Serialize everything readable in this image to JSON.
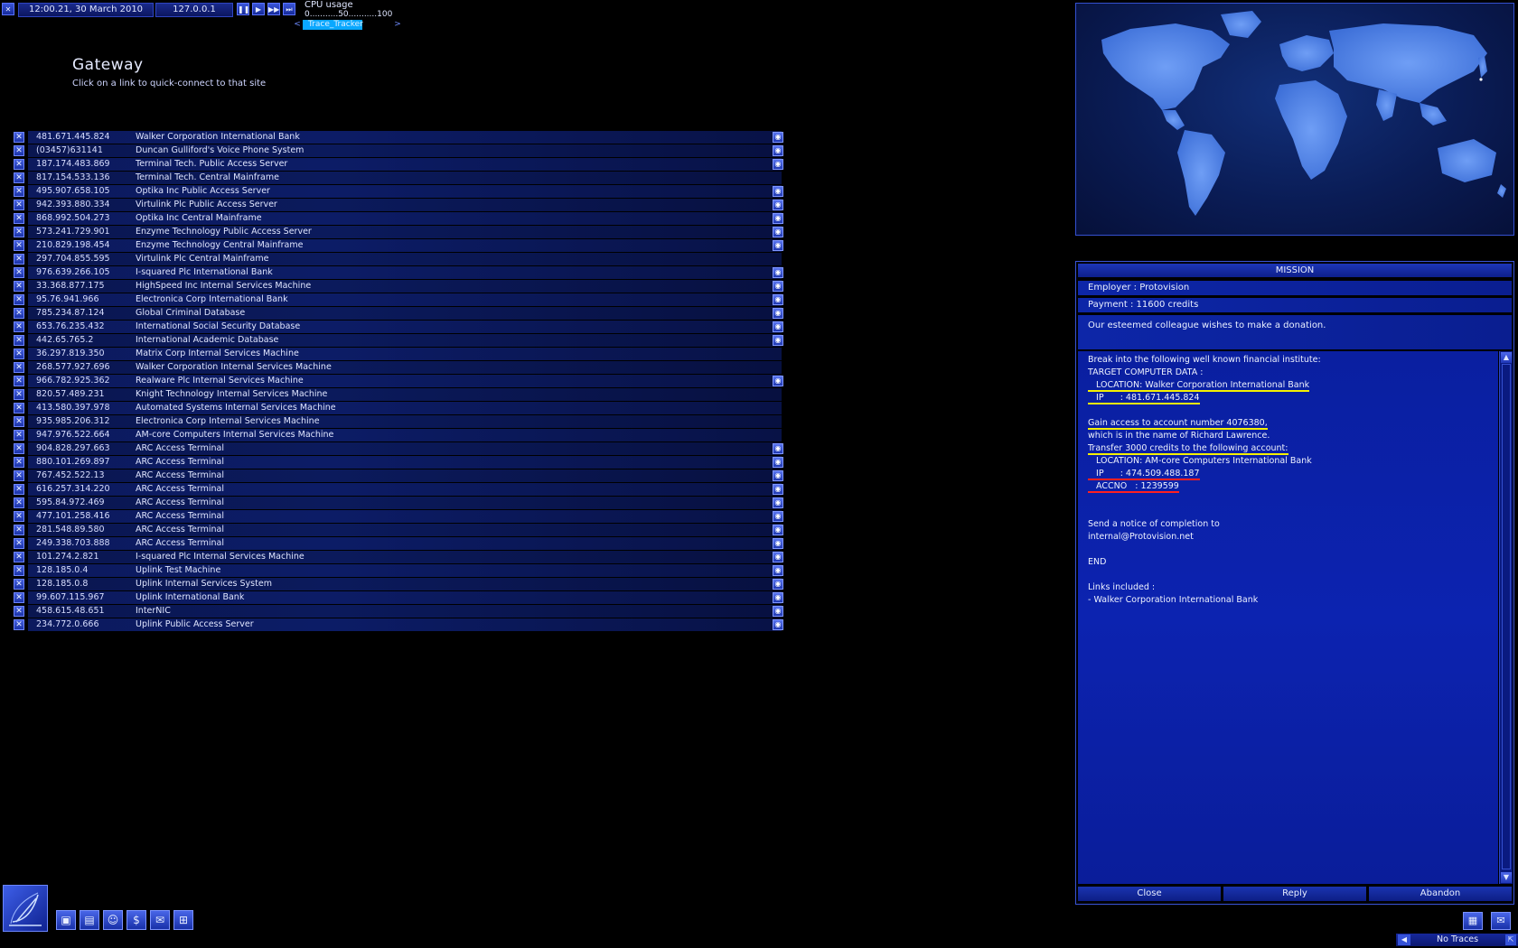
{
  "topbar": {
    "datetime": "12:00.21, 30 March 2010",
    "local_ip": "127.0.0.1",
    "cpu_label": "CPU usage",
    "cpu_scale": "0...........50...........100",
    "trace_program": "Trace_Tracker"
  },
  "gateway": {
    "title": "Gateway",
    "subtitle": "Click on a link to quick-connect to that site",
    "links": [
      {
        "ip": "481.671.445.824",
        "name": "Walker Corporation International Bank",
        "icon": true
      },
      {
        "ip": "(03457)631141",
        "name": "Duncan Gulliford's Voice Phone System",
        "icon": true
      },
      {
        "ip": "187.174.483.869",
        "name": "Terminal Tech. Public Access Server",
        "icon": true
      },
      {
        "ip": "817.154.533.136",
        "name": "Terminal Tech. Central Mainframe",
        "icon": false
      },
      {
        "ip": "495.907.658.105",
        "name": "Optika Inc Public Access Server",
        "icon": true
      },
      {
        "ip": "942.393.880.334",
        "name": "Virtulink Plc Public Access Server",
        "icon": true
      },
      {
        "ip": "868.992.504.273",
        "name": "Optika Inc Central Mainframe",
        "icon": true
      },
      {
        "ip": "573.241.729.901",
        "name": "Enzyme Technology Public Access Server",
        "icon": true
      },
      {
        "ip": "210.829.198.454",
        "name": "Enzyme Technology Central Mainframe",
        "icon": true
      },
      {
        "ip": "297.704.855.595",
        "name": "Virtulink Plc Central Mainframe",
        "icon": false
      },
      {
        "ip": "976.639.266.105",
        "name": "I-squared Plc International Bank",
        "icon": true
      },
      {
        "ip": "33.368.877.175",
        "name": "HighSpeed Inc Internal Services Machine",
        "icon": true
      },
      {
        "ip": "95.76.941.966",
        "name": "Electronica Corp International Bank",
        "icon": true
      },
      {
        "ip": "785.234.87.124",
        "name": "Global Criminal Database",
        "icon": true
      },
      {
        "ip": "653.76.235.432",
        "name": "International Social Security Database",
        "icon": true
      },
      {
        "ip": "442.65.765.2",
        "name": "International Academic Database",
        "icon": true
      },
      {
        "ip": "36.297.819.350",
        "name": "Matrix Corp Internal Services Machine",
        "icon": false
      },
      {
        "ip": "268.577.927.696",
        "name": "Walker Corporation Internal Services Machine",
        "icon": false
      },
      {
        "ip": "966.782.925.362",
        "name": "Realware Plc Internal Services Machine",
        "icon": true
      },
      {
        "ip": "820.57.489.231",
        "name": "Knight Technology Internal Services Machine",
        "icon": false
      },
      {
        "ip": "413.580.397.978",
        "name": "Automated Systems Internal Services Machine",
        "icon": false
      },
      {
        "ip": "935.985.206.312",
        "name": "Electronica Corp Internal Services Machine",
        "icon": false
      },
      {
        "ip": "947.976.522.664",
        "name": "AM-core Computers Internal Services Machine",
        "icon": false
      },
      {
        "ip": "904.828.297.663",
        "name": "ARC Access Terminal",
        "icon": true
      },
      {
        "ip": "880.101.269.897",
        "name": "ARC Access Terminal",
        "icon": true
      },
      {
        "ip": "767.452.522.13",
        "name": "ARC Access Terminal",
        "icon": true
      },
      {
        "ip": "616.257.314.220",
        "name": "ARC Access Terminal",
        "icon": true
      },
      {
        "ip": "595.84.972.469",
        "name": "ARC Access Terminal",
        "icon": true
      },
      {
        "ip": "477.101.258.416",
        "name": "ARC Access Terminal",
        "icon": true
      },
      {
        "ip": "281.548.89.580",
        "name": "ARC Access Terminal",
        "icon": true
      },
      {
        "ip": "249.338.703.888",
        "name": "ARC Access Terminal",
        "icon": true
      },
      {
        "ip": "101.274.2.821",
        "name": "I-squared Plc Internal Services Machine",
        "icon": true
      },
      {
        "ip": "128.185.0.4",
        "name": "Uplink Test Machine",
        "icon": true
      },
      {
        "ip": "128.185.0.8",
        "name": "Uplink Internal Services System",
        "icon": true
      },
      {
        "ip": "99.607.115.967",
        "name": "Uplink International Bank",
        "icon": true
      },
      {
        "ip": "458.615.48.651",
        "name": "InterNIC",
        "icon": true
      },
      {
        "ip": "234.772.0.666",
        "name": "Uplink Public Access Server",
        "icon": true
      }
    ]
  },
  "mission": {
    "title": "MISSION",
    "employer": "Employer : Protovision",
    "payment": "Payment : 11600 credits",
    "description": "Our esteemed colleague wishes to make a donation.",
    "body": [
      "Break into the following well known financial institute:",
      "TARGET COMPUTER DATA :",
      "   LOCATION: Walker Corporation International Bank",
      "   IP      : 481.671.445.824",
      "",
      "Gain access to account number 4076380,",
      "which is in the name of Richard Lawrence.",
      "Transfer 3000 credits to the following account:",
      "   LOCATION: AM-core Computers International Bank",
      "   IP      : 474.509.488.187",
      "   ACCNO   : 1239599",
      "",
      "",
      "Send a notice of completion to",
      "internal@Protovision.net",
      "",
      "END",
      "",
      "Links included :",
      "- Walker Corporation International Bank"
    ],
    "buttons": {
      "close": "Close",
      "reply": "Reply",
      "abandon": "Abandon"
    }
  },
  "status": {
    "traces": "No Traces"
  },
  "colors": {
    "accent": "#1a34b0",
    "panel": "#0c23b0",
    "highlight_yellow": "#f5f000",
    "highlight_red": "#ff2020"
  }
}
